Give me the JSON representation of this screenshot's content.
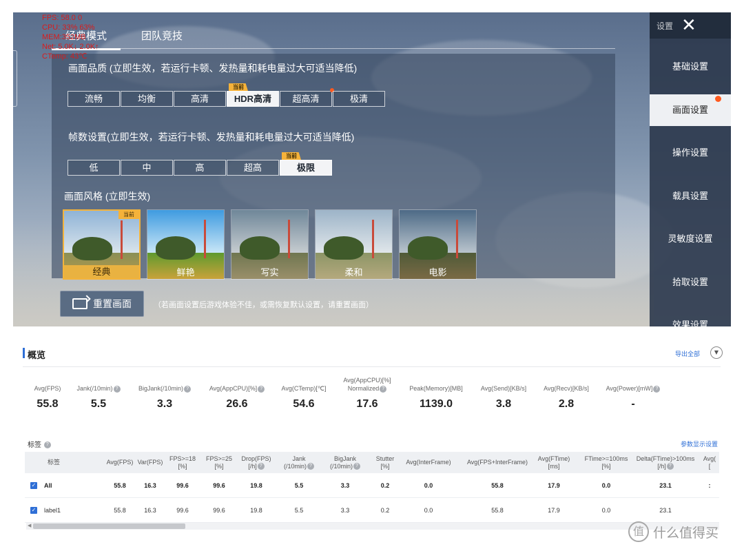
{
  "hud": {
    "fps": "FPS: 58.0   0",
    "cpu": "CPU:  33%  63%",
    "mem": "MEM:352MB",
    "net": "Net:   5.0K↓   2.0K↑",
    "ctemp": "CTemp: 43℃"
  },
  "mode_tabs": [
    "经典模式",
    "团队竞技"
  ],
  "quality": {
    "title": "画面品质 (立即生效，若运行卡顿、发热量和耗电量过大可适当降低)",
    "options": [
      "流畅",
      "均衡",
      "高清",
      "HDR高清",
      "超高清",
      "极清"
    ],
    "selected": "HDR高清",
    "current_tag": "当前"
  },
  "framerate": {
    "title": "帧数设置(立即生效，若运行卡顿、发热量和耗电量过大可适当降低)",
    "options": [
      "低",
      "中",
      "高",
      "超高",
      "极限"
    ],
    "selected": "极限",
    "current_tag": "当前"
  },
  "style": {
    "title": "画面风格 (立即生效)",
    "options": [
      "经典",
      "鲜艳",
      "写实",
      "柔和",
      "电影"
    ],
    "selected": "经典",
    "current_tag": "当前"
  },
  "reset": {
    "button": "重置画面",
    "note": "（若画面设置后游戏体验不佳，或需恢复默认设置，请重置画面）"
  },
  "side_menu": {
    "header": "设置",
    "close_icon": "close-icon",
    "items": [
      "基础设置",
      "画面设置",
      "操作设置",
      "载具设置",
      "灵敏度设置",
      "拾取设置",
      "效果设置"
    ],
    "selected": "画面设置"
  },
  "overview": {
    "title": "概览",
    "export": "导出全部",
    "expand_icon": "chevron-down-icon",
    "metrics": [
      {
        "label": "Avg(FPS)",
        "help": false,
        "value": "55.8"
      },
      {
        "label": "Jank(/10min)",
        "help": true,
        "value": "5.5"
      },
      {
        "label": "BigJank(/10min)",
        "help": true,
        "value": "3.3"
      },
      {
        "label": "Avg(AppCPU)[%]",
        "help": true,
        "value": "26.6"
      },
      {
        "label": "Avg(CTemp)[℃]",
        "help": false,
        "value": "54.6"
      },
      {
        "label": "Avg(AppCPU)[%]",
        "label2": "Normalized",
        "help": true,
        "value": "17.6"
      },
      {
        "label": "Peak(Memory)[MB]",
        "help": false,
        "value": "1139.0"
      },
      {
        "label": "Avg(Send)[KB/s]",
        "help": false,
        "value": "3.8"
      },
      {
        "label": "Avg(Recv)[KB/s]",
        "help": false,
        "value": "2.8"
      },
      {
        "label": "Avg(Power)[mW]",
        "help": true,
        "value": "-"
      }
    ]
  },
  "tags_section": {
    "title": "标签",
    "param_link": "参数显示设置",
    "columns": [
      {
        "l1": "标签",
        "l2": "",
        "help": false
      },
      {
        "l1": "Avg(FPS)",
        "l2": "",
        "help": false
      },
      {
        "l1": "Var(FPS)",
        "l2": "",
        "help": false
      },
      {
        "l1": "FPS>=18",
        "l2": "[%]",
        "help": false
      },
      {
        "l1": "FPS>=25",
        "l2": "[%]",
        "help": false
      },
      {
        "l1": "Drop(FPS)",
        "l2": "[/h]",
        "help": true
      },
      {
        "l1": "Jank",
        "l2": "(/10min)",
        "help": true
      },
      {
        "l1": "BigJank",
        "l2": "(/10min)",
        "help": true
      },
      {
        "l1": "Stutter",
        "l2": "[%]",
        "help": false
      },
      {
        "l1": "Avg(InterFrame)",
        "l2": "",
        "help": false
      },
      {
        "l1": "Avg(FPS+InterFrame)",
        "l2": "",
        "help": false
      },
      {
        "l1": "Avg(FTime)",
        "l2": "[ms]",
        "help": false
      },
      {
        "l1": "FTime>=100ms",
        "l2": "[%]",
        "help": false
      },
      {
        "l1": "Delta(FTime)>100ms",
        "l2": "[/h]",
        "help": true
      },
      {
        "l1": "Avg(",
        "l2": "[",
        "help": false
      }
    ],
    "rows": [
      {
        "checked": true,
        "cells": [
          "All",
          "55.8",
          "16.3",
          "99.6",
          "99.6",
          "19.8",
          "5.5",
          "3.3",
          "0.2",
          "0.0",
          "55.8",
          "17.9",
          "0.0",
          "23.1",
          ":"
        ]
      },
      {
        "checked": true,
        "cells": [
          "label1",
          "55.8",
          "16.3",
          "99.6",
          "99.6",
          "19.8",
          "5.5",
          "3.3",
          "0.2",
          "0.0",
          "55.8",
          "17.9",
          "0.0",
          "23.1",
          ""
        ]
      }
    ]
  },
  "watermark": {
    "logo": "值",
    "text": "什么值得买"
  }
}
